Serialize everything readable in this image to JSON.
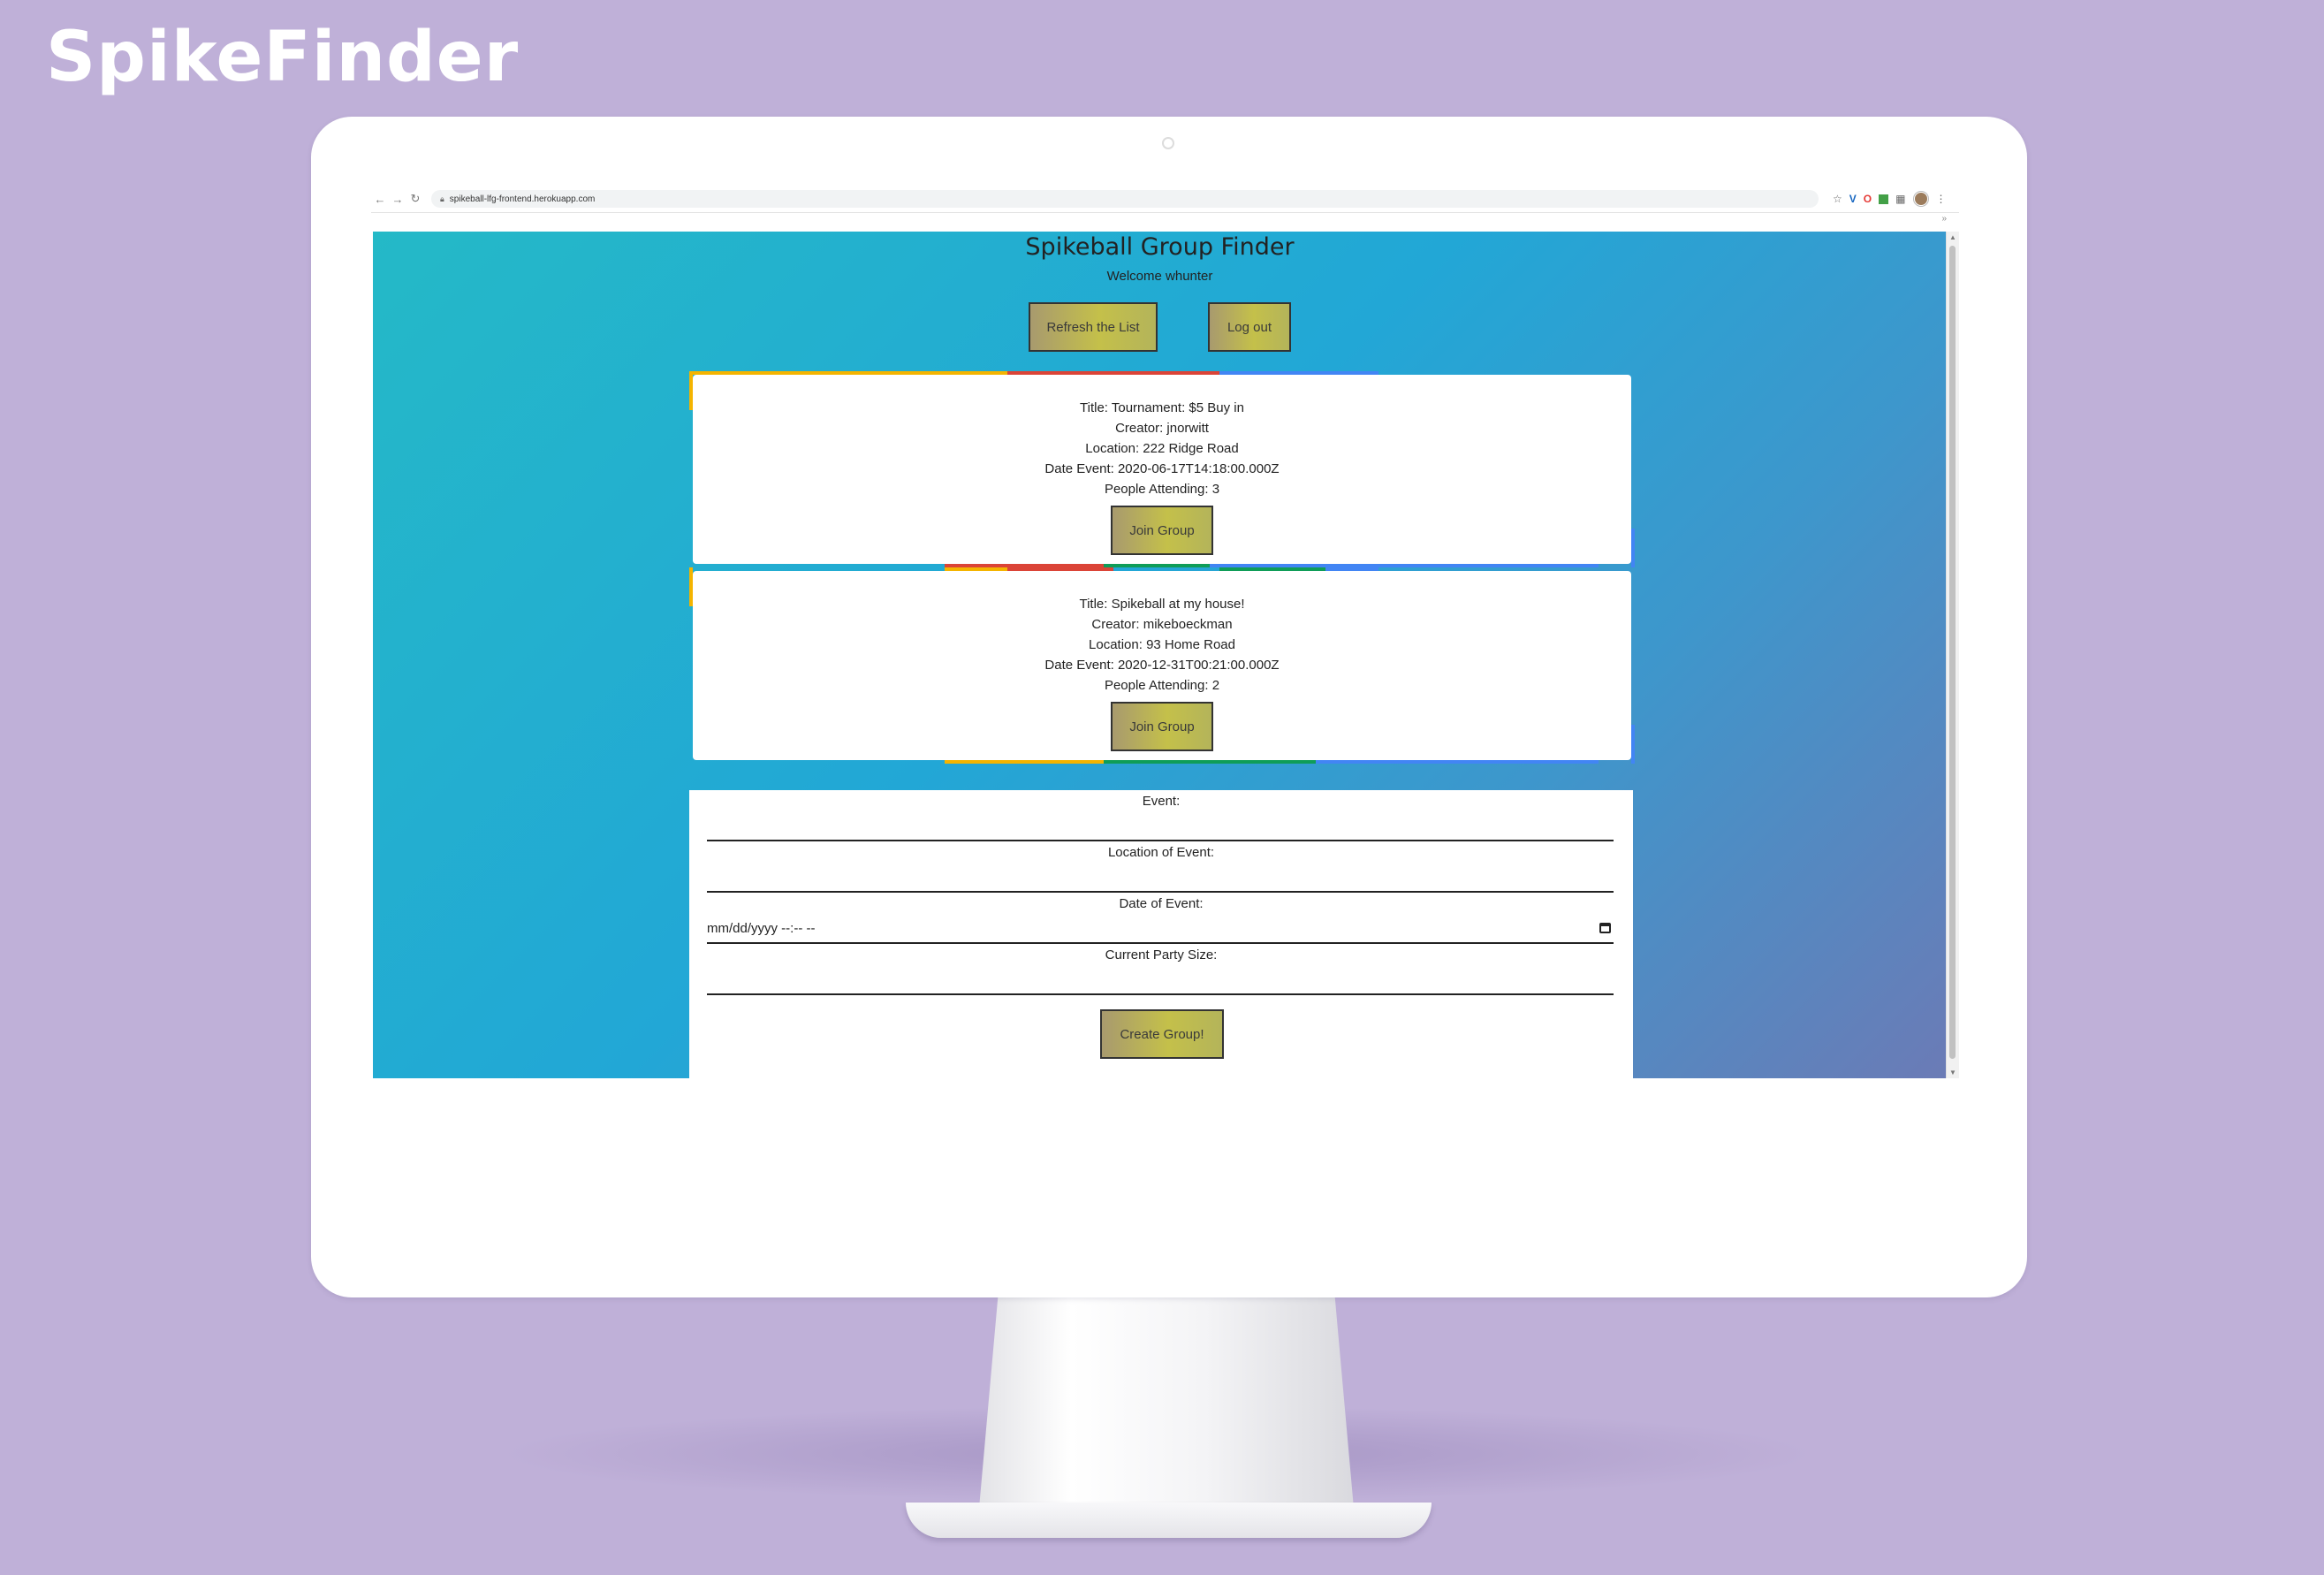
{
  "brand": {
    "title": "SpikeFinder"
  },
  "browser": {
    "url": "spikeball-lfg-frontend.herokuapp.com",
    "overflow_label": "»"
  },
  "page": {
    "title": "Spikeball Group Finder",
    "welcome": "Welcome whunter",
    "refresh_label": "Refresh the List",
    "logout_label": "Log out"
  },
  "groups": [
    {
      "title": "Title: Tournament: $5 Buy in",
      "creator": "Creator: jnorwitt",
      "location": "Location: 222 Ridge Road",
      "date": "Date Event: 2020-06-17T14:18:00.000Z",
      "attending": "People Attending: 3",
      "join_label": "Join Group"
    },
    {
      "title": "Title: Spikeball at my house!",
      "creator": "Creator: mikeboeckman",
      "location": "Location: 93 Home Road",
      "date": "Date Event: 2020-12-31T00:21:00.000Z",
      "attending": "People Attending: 2",
      "join_label": "Join Group"
    }
  ],
  "form": {
    "event_label": "Event:",
    "location_label": "Location of Event:",
    "date_label": "Date of Event:",
    "date_placeholder": "mm/dd/yyyy --:-- --",
    "party_label": "Current Party Size:",
    "submit_label": "Create Group!"
  },
  "colors": {
    "background": "#bfb0d8",
    "gradient_start": "#24b9c7",
    "gradient_end": "#6b7bb6",
    "button_gold": "#c4c04a",
    "accent_yellow": "#f4b400",
    "accent_red": "#db4437",
    "accent_green": "#0f9d58",
    "accent_blue": "#4285f4"
  }
}
